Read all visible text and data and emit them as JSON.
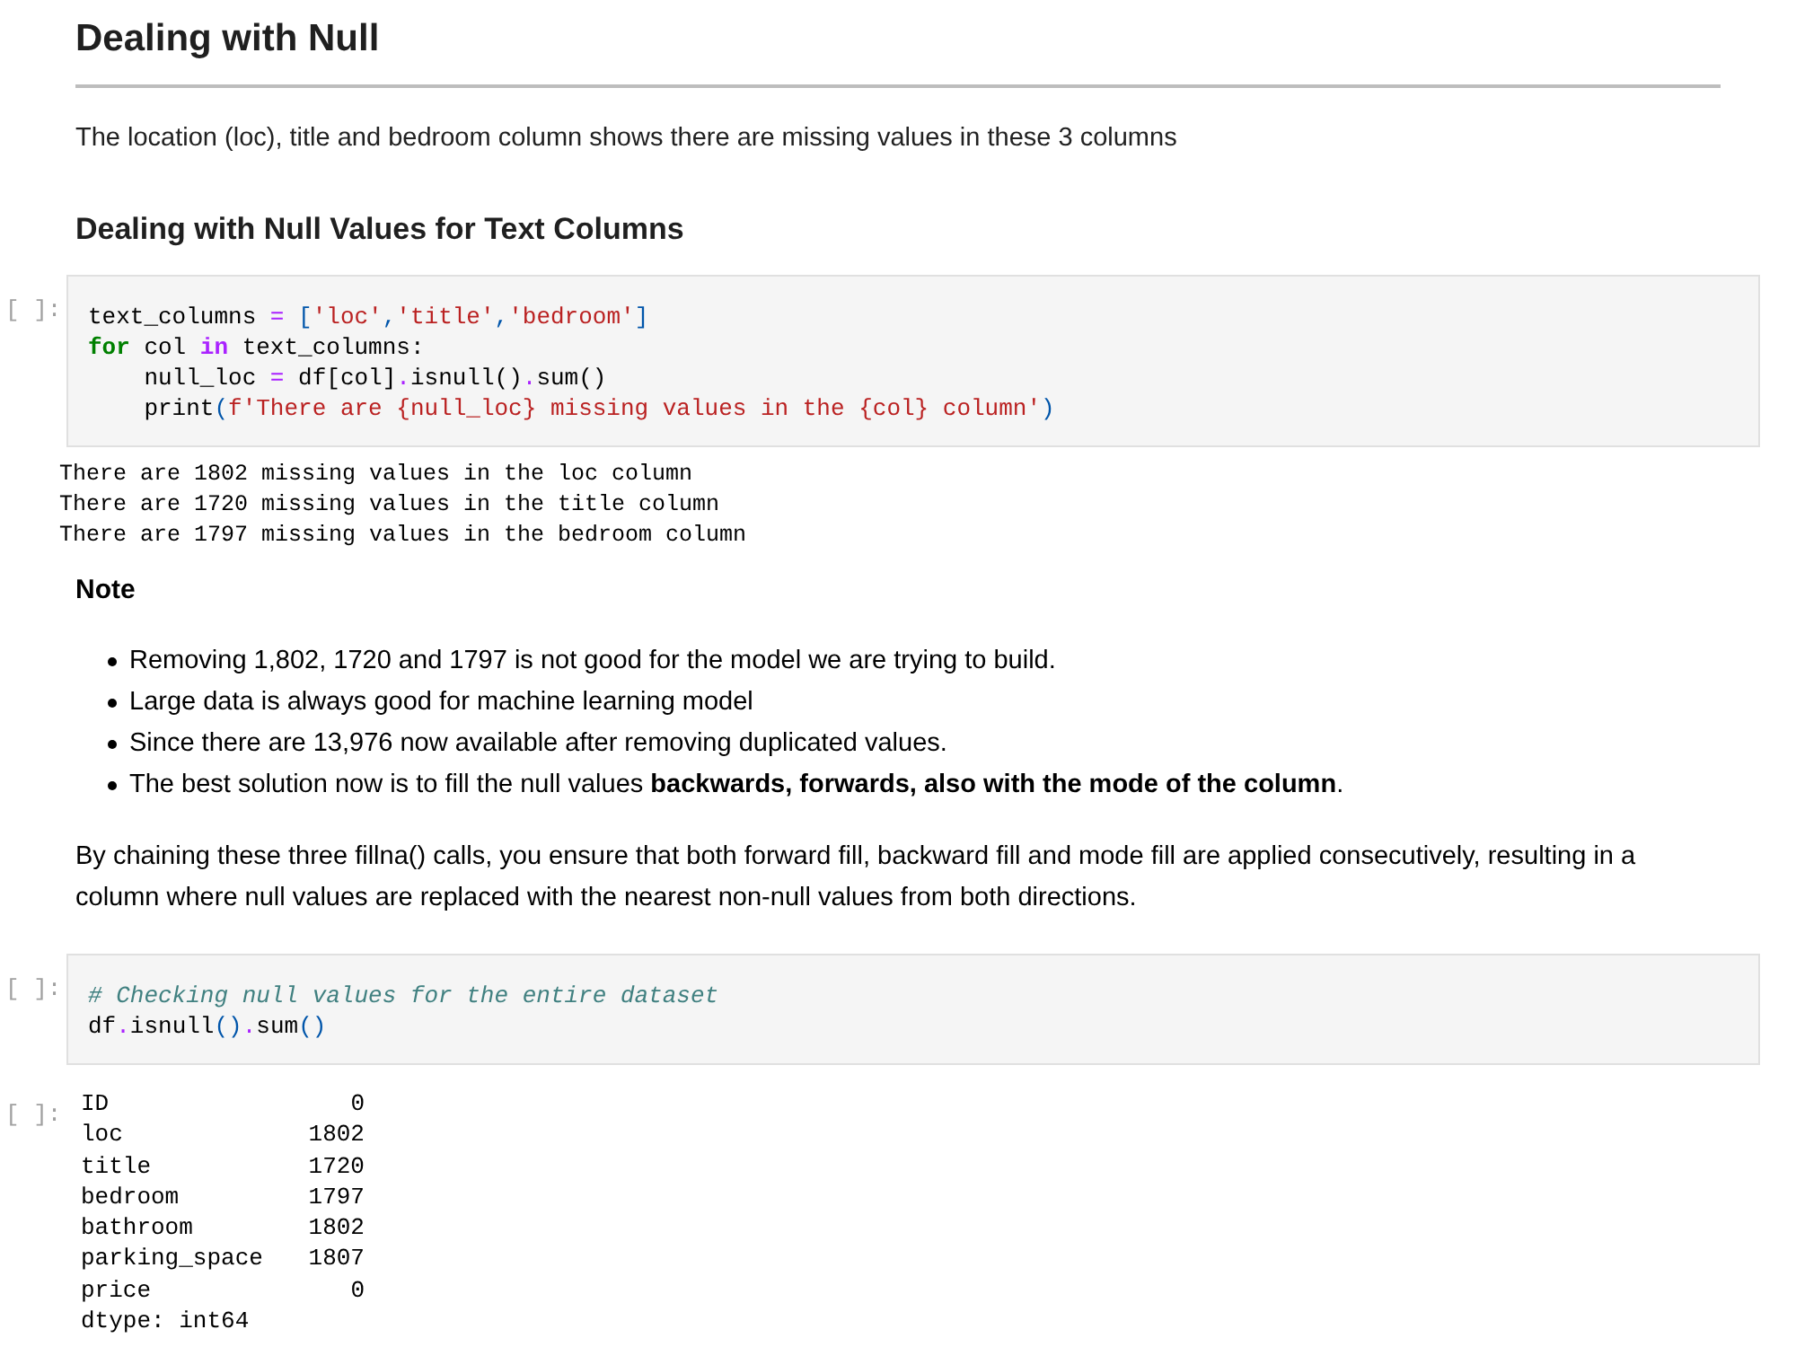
{
  "heading": "Dealing with Null",
  "intro": "The location (loc), title and bedroom column shows there are missing values in these 3 columns",
  "subheading": "Dealing with Null Values for Text Columns",
  "code_cell_1": {
    "prompt": "[ ]:",
    "lines": [
      [
        {
          "text": "text_columns ",
          "kind": "plain"
        },
        {
          "text": "=",
          "kind": "operator"
        },
        {
          "text": " [",
          "kind": "punct"
        },
        {
          "text": "'loc'",
          "kind": "string"
        },
        {
          "text": ",",
          "kind": "punct"
        },
        {
          "text": "'title'",
          "kind": "string"
        },
        {
          "text": ",",
          "kind": "punct"
        },
        {
          "text": "'bedroom'",
          "kind": "string"
        },
        {
          "text": "]",
          "kind": "punct"
        }
      ],
      [
        {
          "text": "for",
          "kind": "keyword"
        },
        {
          "text": " col ",
          "kind": "plain"
        },
        {
          "text": "in",
          "kind": "word"
        },
        {
          "text": " text_columns:",
          "kind": "plain"
        }
      ],
      [
        {
          "text": "    null_loc ",
          "kind": "plain"
        },
        {
          "text": "=",
          "kind": "operator"
        },
        {
          "text": " df[col]",
          "kind": "plain"
        },
        {
          "text": ".",
          "kind": "operator"
        },
        {
          "text": "isnull()",
          "kind": "plain"
        },
        {
          "text": ".",
          "kind": "operator"
        },
        {
          "text": "sum()",
          "kind": "plain"
        }
      ],
      [
        {
          "text": "    print",
          "kind": "plain"
        },
        {
          "text": "(",
          "kind": "punct"
        },
        {
          "text": "f'There are {null_loc} missing values in the {col} column'",
          "kind": "string"
        },
        {
          "text": ")",
          "kind": "punct"
        }
      ]
    ]
  },
  "output_1": {
    "lines": [
      "There are 1802 missing values in the loc column",
      "There are 1720 missing values in the title column",
      "There are 1797 missing values in the bedroom column"
    ]
  },
  "note": {
    "title": "Note",
    "bullets": [
      "Removing 1,802, 1720 and 1797 is not good for the model we are trying to build.",
      "Large data is always good for machine learning model",
      "Since there are 13,976 now available after removing duplicated values.",
      "The best solution now is to fill the null values **backwards, forwards, also with the mode of the column**."
    ],
    "paragraph": "By chaining these three fillna() calls, you ensure that both forward fill, backward fill and mode fill are applied consecutively, resulting in a column where null values are replaced with the nearest non-null values from both directions."
  },
  "code_cell_2": {
    "prompt": "[ ]:",
    "lines": [
      [
        {
          "text": "# Checking null values for the entire dataset",
          "kind": "comment"
        }
      ],
      [
        {
          "text": "df",
          "kind": "plain"
        },
        {
          "text": ".",
          "kind": "operator"
        },
        {
          "text": "isnull",
          "kind": "plain"
        },
        {
          "text": "()",
          "kind": "punct"
        },
        {
          "text": ".",
          "kind": "operator"
        },
        {
          "text": "sum",
          "kind": "plain"
        },
        {
          "text": "()",
          "kind": "punct"
        }
      ]
    ]
  },
  "output_2": {
    "prompt": "[ ]:",
    "rows": [
      {
        "label": "ID",
        "value": "0"
      },
      {
        "label": "loc",
        "value": "1802"
      },
      {
        "label": "title",
        "value": "1720"
      },
      {
        "label": "bedroom",
        "value": "1797"
      },
      {
        "label": "bathroom",
        "value": "1802"
      },
      {
        "label": "parking_space",
        "value": "1807"
      },
      {
        "label": "price",
        "value": "0"
      }
    ],
    "footer": "dtype: int64"
  }
}
